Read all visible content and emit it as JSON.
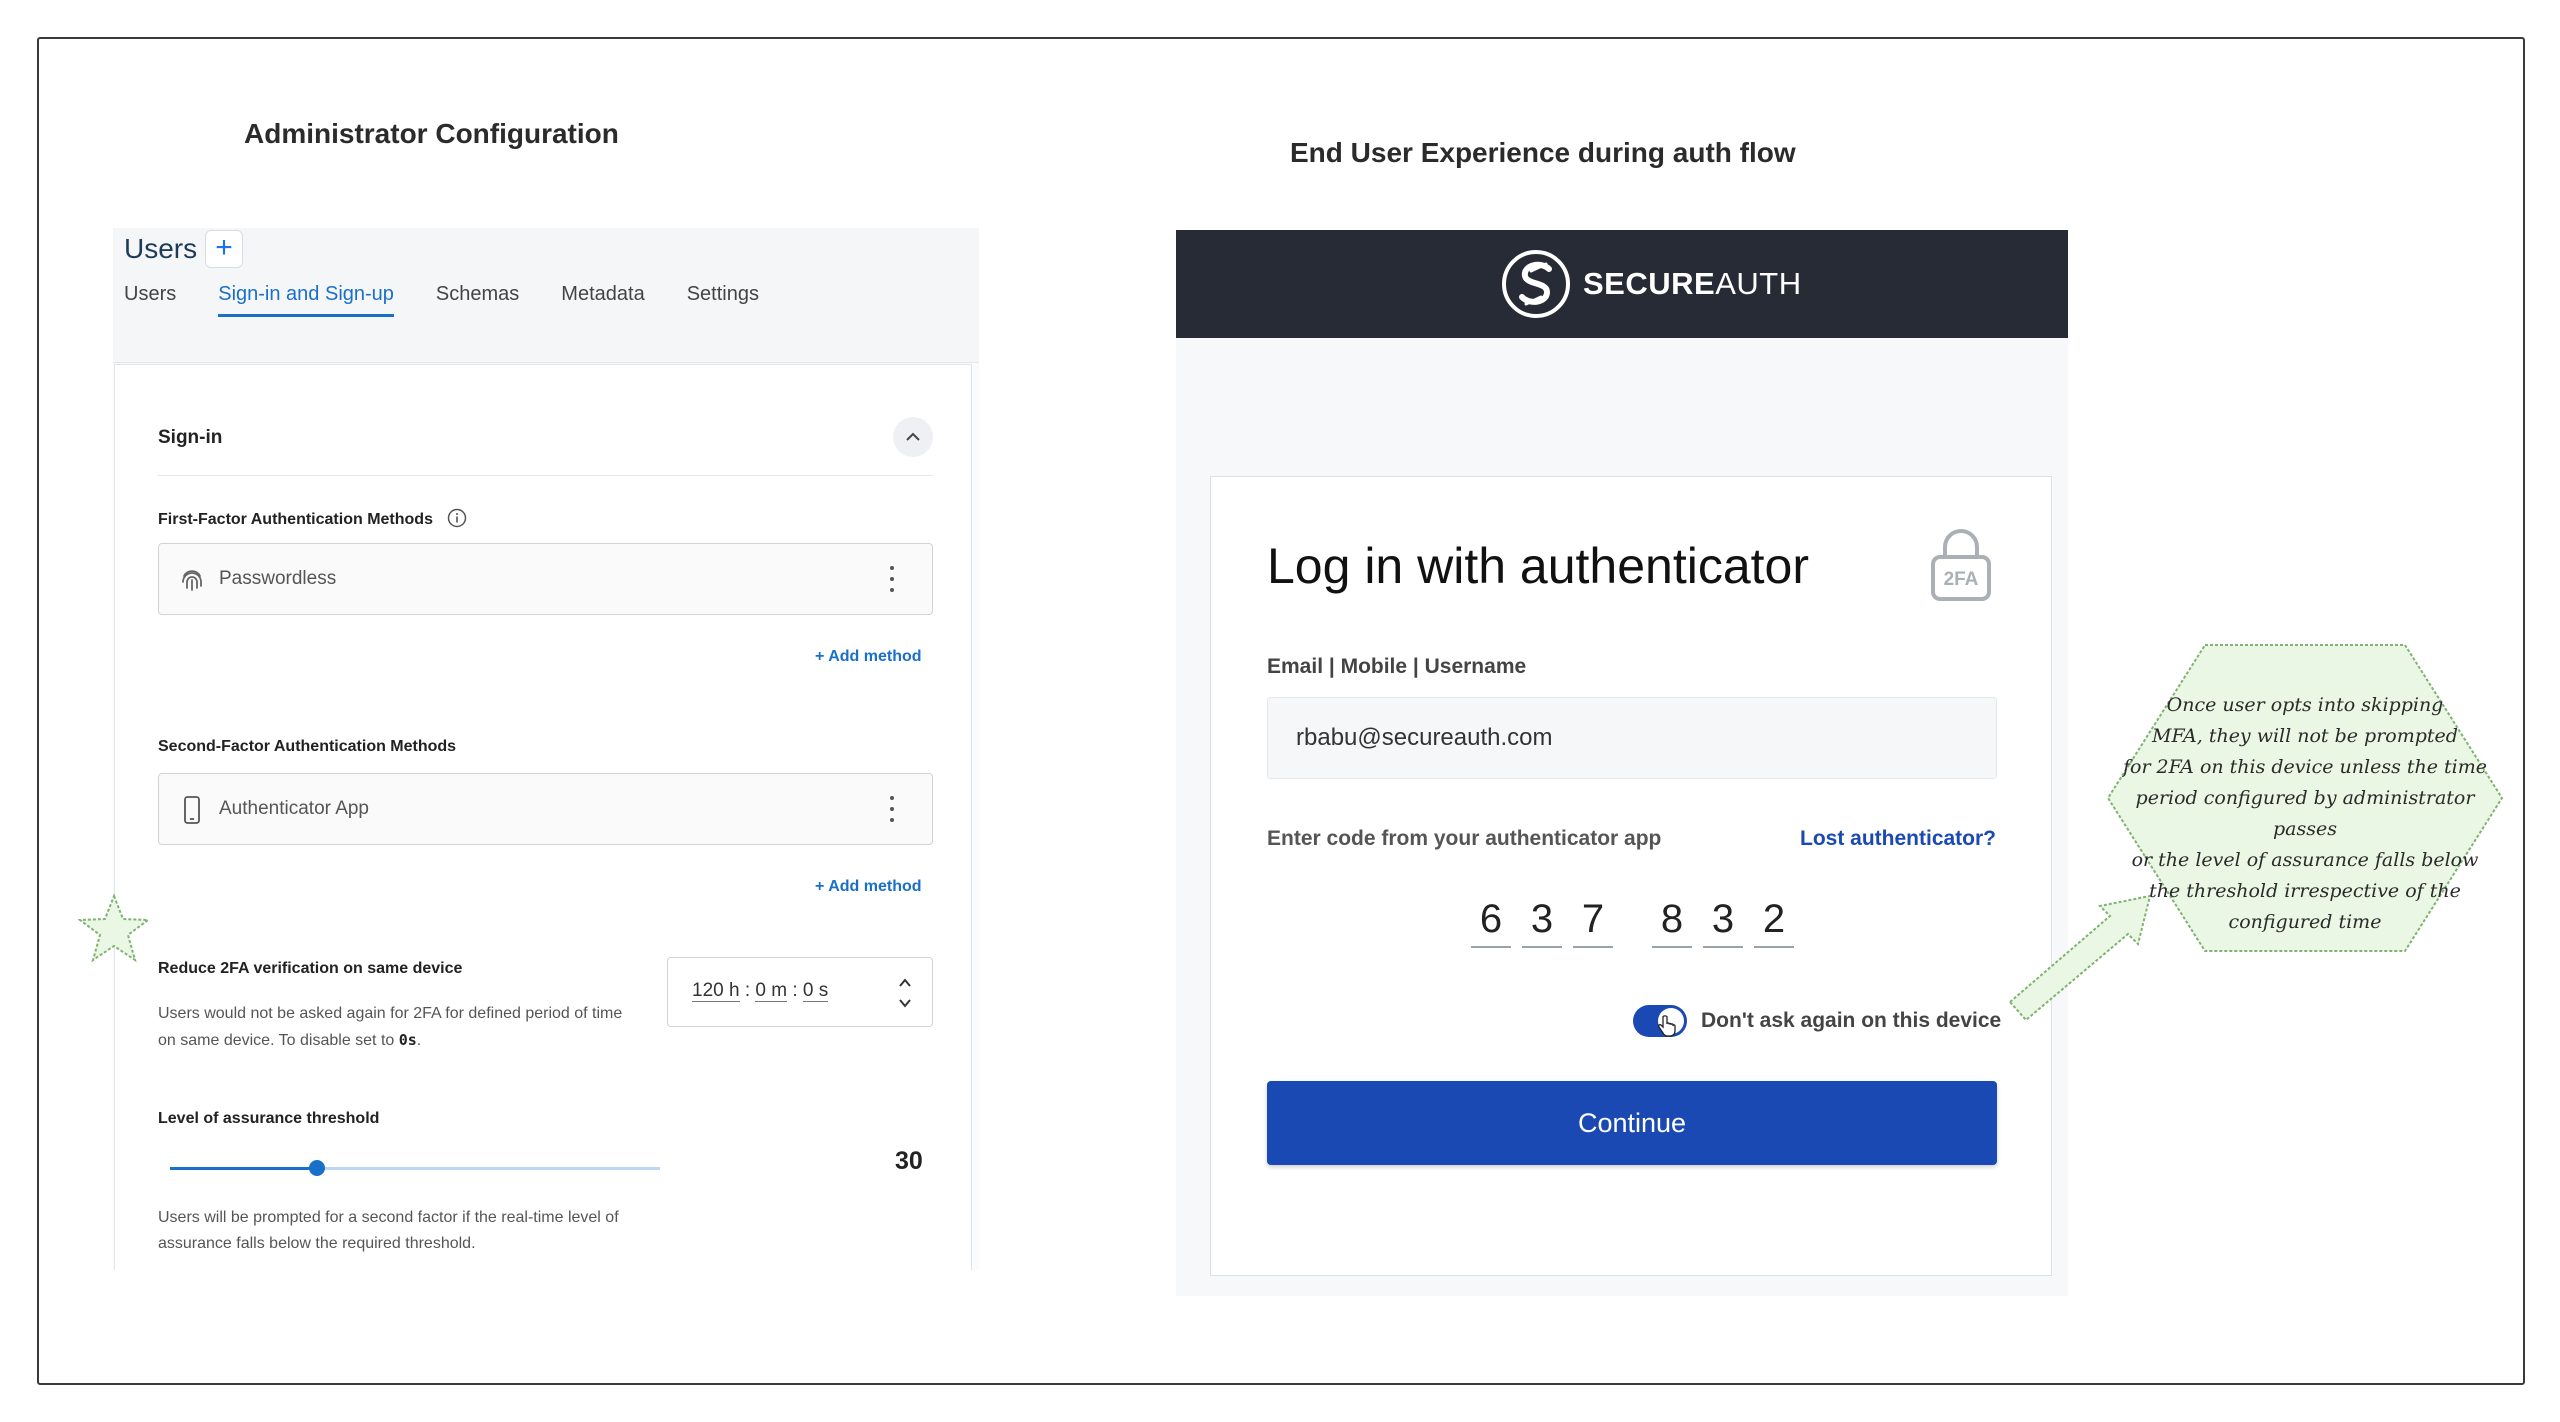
{
  "headings": {
    "admin": "Administrator Configuration",
    "end_user": "End User Experience during auth flow"
  },
  "admin": {
    "title": "Users",
    "add_label": "+",
    "tabs": [
      {
        "label": "Users",
        "active": false
      },
      {
        "label": "Sign-in and Sign-up",
        "active": true
      },
      {
        "label": "Schemas",
        "active": false
      },
      {
        "label": "Metadata",
        "active": false
      },
      {
        "label": "Settings",
        "active": false
      }
    ],
    "section_title": "Sign-in",
    "first_factor": {
      "label": "First-Factor Authentication Methods",
      "method": "Passwordless",
      "method_icon": "fingerprint-icon",
      "add_label": "+ Add method"
    },
    "second_factor": {
      "label": "Second-Factor Authentication Methods",
      "method": "Authenticator App",
      "method_icon": "phone-icon",
      "add_label": "+ Add method"
    },
    "reduce_2fa": {
      "label": "Reduce 2FA verification on same device",
      "desc_line1": "Users would not be asked again for 2FA for defined period of time",
      "desc_line2": "on same device. To disable set to ",
      "desc_code": "0s",
      "desc_end": ".",
      "hours": "120 h",
      "minutes": "0 m",
      "seconds": "0 s",
      "sep": ":"
    },
    "assurance": {
      "label": "Level of assurance threshold",
      "value": "30",
      "value_fraction": 0.3,
      "desc_line1": "Users will be prompted for a second factor if the real-time level of",
      "desc_line2": "assurance falls below the required threshold."
    }
  },
  "end_user": {
    "brand_bold": "SECURE",
    "brand_light": "AUTH",
    "login_title": "Log in with authenticator",
    "lock_badge": "2FA",
    "field_label": "Email | Mobile | Username",
    "email_value": "rbabu@secureauth.com",
    "code_label": "Enter code from your authenticator app",
    "lost_link": "Lost authenticator?",
    "code_digits": [
      "6",
      "3",
      "7",
      "8",
      "3",
      "2"
    ],
    "toggle_label": "Don't ask again on this device",
    "toggle_on": true,
    "continue_label": "Continue"
  },
  "annotation": {
    "lines": [
      "Once user opts into skipping",
      "MFA, they will not be prompted",
      "for 2FA on this device unless the time",
      "period configured by administrator passes",
      "or the level of assurance falls below",
      "the threshold irrespective of the",
      "configured time"
    ]
  },
  "colors": {
    "accent_admin": "#1a6fc9",
    "accent_enduser": "#1b49b4",
    "header_dark": "#272b35",
    "callout_fill": "#e9f7e4"
  }
}
